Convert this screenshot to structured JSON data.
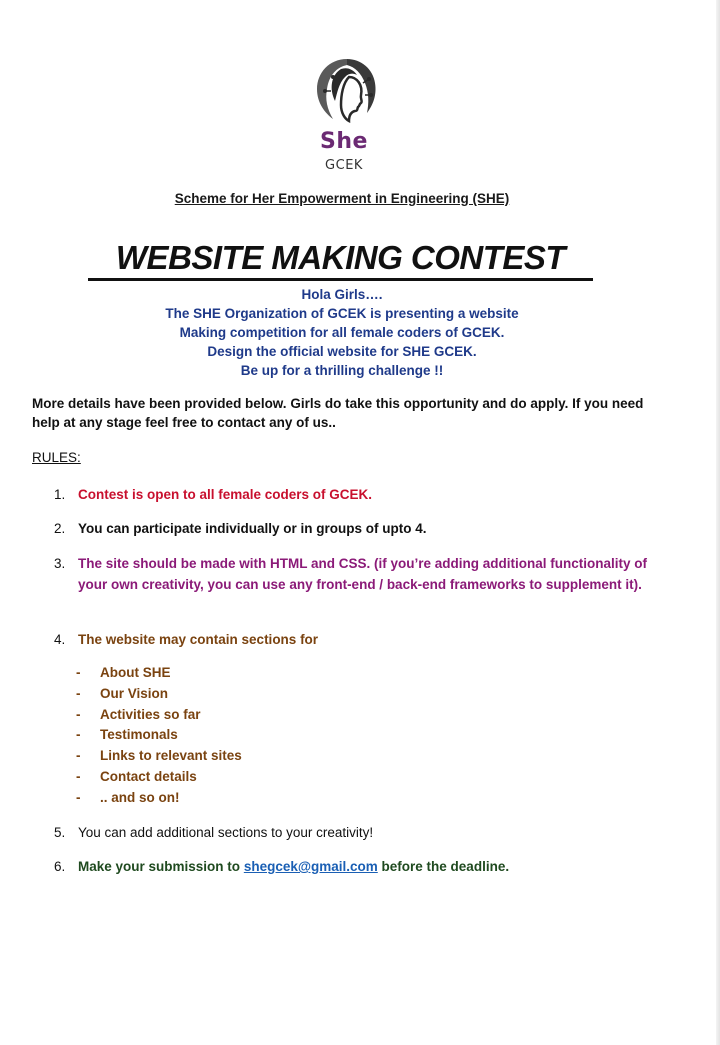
{
  "brand": {
    "name": "She",
    "sub": "GCEK",
    "colors": {
      "purple": "#6b2a73",
      "dark": "#333333"
    }
  },
  "scheme_title": "Scheme for Her Empowerment in Engineering (SHE)",
  "contest_title": "WEBSITE MAKING CONTEST",
  "intro": {
    "lines": [
      "Hola Girls….",
      "The SHE Organization of GCEK is presenting a website",
      "Making competition for all female coders of GCEK.",
      "Design the official website for SHE GCEK.",
      "Be up for a thrilling challenge !!"
    ],
    "color": "#1f3a8a"
  },
  "more_details": "More details have been provided below. Girls do take this opportunity and do apply. If you need help at any stage feel free to contact any of us..",
  "rules_heading": "RULES:",
  "rules": [
    {
      "number": "1.",
      "text": "Contest is open to all female coders of GCEK.",
      "color": "#c8102e"
    },
    {
      "number": "2.",
      "text": "You can participate individually or in groups of upto 4.",
      "color": "#111111"
    },
    {
      "number": "3.",
      "text": "The site should be made with HTML and  CSS. (if you’re adding additional functionality of your own creativity, you can use any front-end / back-end frameworks to supplement it).",
      "color": "#8b1a78"
    },
    {
      "number": "4.",
      "text": "The website may contain sections for",
      "color": "#7a4310"
    },
    {
      "number": "5.",
      "text": "You can add additional sections to your creativity!",
      "color": "#111111"
    },
    {
      "number": "6.",
      "text_before": "Make your submission to",
      "email": "shegcek@gmail.com",
      "text_after": "before the deadline.",
      "color": "#1f4a1f"
    }
  ],
  "sections": {
    "bullet": "-",
    "items": [
      "About SHE",
      "Our Vision",
      "Activities so far",
      "Testimonals",
      "Links to relevant sites",
      "Contact details",
      ".. and so on!"
    ]
  },
  "icons": {
    "logo": "she-logo-icon"
  }
}
